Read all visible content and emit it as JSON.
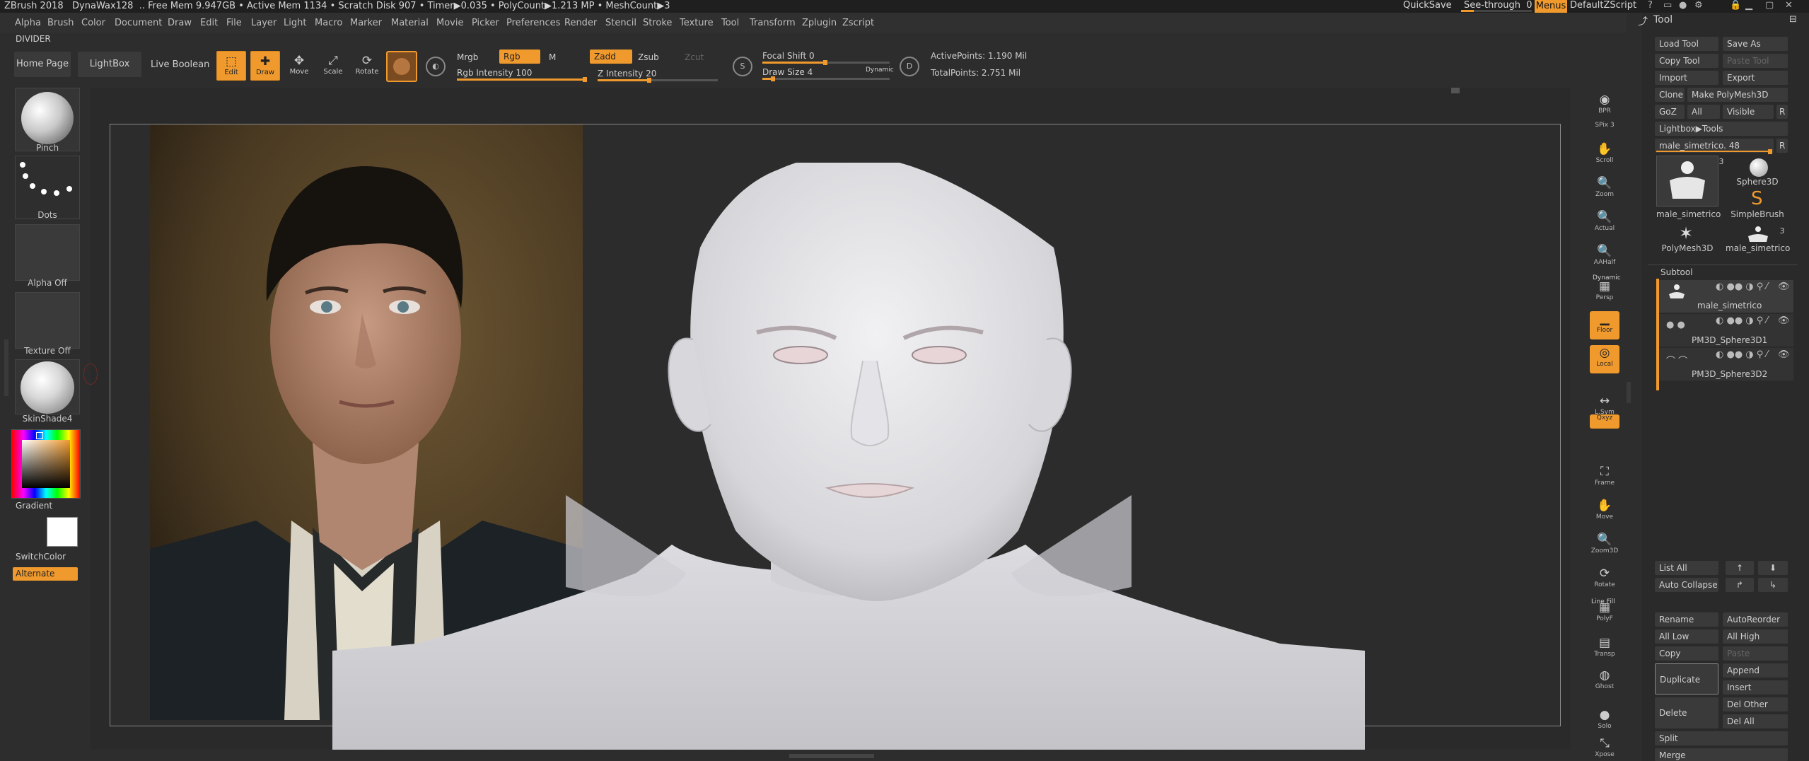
{
  "titlebar": {
    "app": "ZBrush 2018",
    "brush": "DynaWax128",
    "stats": "Free Mem 9.947GB • Active Mem 1134 • Scratch Disk 907 • Timer▶0.035 • PolyCount▶1.213 MP • MeshCount▶3",
    "quicksave": "QuickSave",
    "see_through": "See-through",
    "see_through_value": "0",
    "menus": "Menus",
    "script": "DefaultZScript"
  },
  "menubar": [
    "Alpha",
    "Brush",
    "Color",
    "Document",
    "Draw",
    "Edit",
    "File",
    "Layer",
    "Light",
    "Macro",
    "Marker",
    "Material",
    "Movie",
    "Picker",
    "Preferences",
    "Render",
    "Stencil",
    "Stroke",
    "Texture",
    "Tool",
    "Transform",
    "Zplugin",
    "Zscript"
  ],
  "divider": "DIVIDER",
  "toolbar": {
    "home_page": "Home Page",
    "lightbox": "LightBox",
    "live_boolean": "Live Boolean",
    "edit": "Edit",
    "draw": "Draw",
    "move": "Move",
    "scale": "Scale",
    "rotate": "Rotate",
    "mrgb": "Mrgb",
    "rgb": "Rgb",
    "m": "M",
    "zadd": "Zadd",
    "zsub": "Zsub",
    "zcut": "Zcut",
    "rgb_intensity_label": "Rgb Intensity",
    "rgb_intensity": "100",
    "z_intensity_label": "Z Intensity",
    "z_intensity": "20",
    "focal_shift_label": "Focal Shift",
    "focal_shift": "0",
    "draw_size_label": "Draw Size",
    "draw_size": "4",
    "dynamic": "Dynamic",
    "active_points": "ActivePoints: 1.190 Mil",
    "total_points": "TotalPoints: 2.751 Mil"
  },
  "left_shelf": {
    "brush": "Pinch",
    "stroke": "Dots",
    "alpha": "Alpha Off",
    "texture": "Texture Off",
    "material": "SkinShade4",
    "gradient": "Gradient",
    "switch_color": "SwitchColor",
    "alternate": "Alternate"
  },
  "right_shelf": [
    {
      "name": "bpr",
      "label": "BPR",
      "icon": "sphere"
    },
    {
      "name": "spix",
      "label": "SPix 3",
      "icon": ""
    },
    {
      "name": "scroll",
      "label": "Scroll",
      "icon": "hand"
    },
    {
      "name": "zoom",
      "label": "Zoom",
      "icon": "magnifier"
    },
    {
      "name": "actual",
      "label": "Actual",
      "icon": "magnifier"
    },
    {
      "name": "aahalf",
      "label": "AAHalf",
      "icon": "magnifier"
    },
    {
      "name": "persp",
      "label": "Persp",
      "icon": "grid"
    },
    {
      "name": "floor",
      "label": "Floor",
      "icon": "floor"
    },
    {
      "name": "local",
      "label": "Local",
      "icon": "target"
    },
    {
      "name": "lsym",
      "label": "L.Sym",
      "icon": "arrows"
    },
    {
      "name": "xyz",
      "label": "Qxyz",
      "icon": "xyz"
    },
    {
      "name": "frame",
      "label": "Frame",
      "icon": "frame"
    },
    {
      "name": "move",
      "label": "Move",
      "icon": "hand"
    },
    {
      "name": "zoom3d",
      "label": "Zoom3D",
      "icon": "magnifier"
    },
    {
      "name": "rotate",
      "label": "Rotate",
      "icon": "rotate"
    },
    {
      "name": "polyf",
      "label": "PolyF",
      "icon": "grid"
    },
    {
      "name": "transp",
      "label": "Transp",
      "icon": "layers"
    },
    {
      "name": "ghost",
      "label": "Ghost",
      "icon": "ghost"
    },
    {
      "name": "solo",
      "label": "Solo",
      "icon": "solo"
    },
    {
      "name": "xpose",
      "label": "Xpose",
      "icon": "xpose"
    }
  ],
  "right_shelf_labels": {
    "dynamic": "Dynamic",
    "line_fill": "Line Fill"
  },
  "tool": {
    "title": "Tool",
    "load_tool": "Load Tool",
    "save_as": "Save As",
    "copy_tool": "Copy Tool",
    "paste_tool": "Paste Tool",
    "import": "Import",
    "export": "Export",
    "clone": "Clone",
    "make_polymesh": "Make PolyMesh3D",
    "goz": "GoZ",
    "all": "All",
    "visible": "Visible",
    "r": "R",
    "lightbox_tools": "Lightbox▶Tools",
    "current_tool": "male_simetrico.",
    "current_tool_value": "48",
    "thumbs": [
      {
        "label": "male_simetrico",
        "badge": "3"
      },
      {
        "label": "Sphere3D",
        "badge": ""
      },
      {
        "label": "SimpleBrush",
        "badge": ""
      },
      {
        "label": "PolyMesh3D",
        "badge": ""
      },
      {
        "label": "male_simetrico",
        "badge": "3"
      }
    ],
    "subtool_title": "Subtool",
    "subtools": [
      "male_simetrico",
      "PM3D_Sphere3D1",
      "PM3D_Sphere3D2"
    ],
    "list_all": "List All",
    "auto_collapse": "Auto Collapse",
    "rename": "Rename",
    "auto_reorder": "AutoReorder",
    "all_low": "All Low",
    "all_high": "All High",
    "copy": "Copy",
    "paste": "Paste",
    "duplicate": "Duplicate",
    "append": "Append",
    "insert": "Insert",
    "delete": "Delete",
    "del_other": "Del Other",
    "del_all": "Del All",
    "split": "Split",
    "merge": "Merge"
  },
  "colors": {
    "accent": "#f09a2d",
    "panel": "#2d2d2d",
    "dark": "#1f1f1f"
  }
}
